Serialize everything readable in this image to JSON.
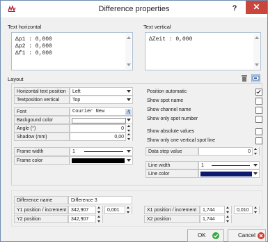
{
  "window": {
    "title": "Difference properties",
    "help": "?",
    "close": "✕"
  },
  "text_horizontal": {
    "label": "Text horizontal",
    "lines": [
      "Δp1 : 0,000",
      "Δp2 : 0,000",
      "Δf1 : 0,000"
    ]
  },
  "text_vertical": {
    "label": "Text vertical",
    "lines": [
      "ΔZeit : 0,000"
    ]
  },
  "layout": {
    "label": "Layout",
    "horizontal_text_position": {
      "label": "Horizontal text position",
      "value": "Left"
    },
    "textposition_vertical": {
      "label": "Textposition vertical",
      "value": "Top"
    },
    "font": {
      "label": "Font",
      "value": "Courier New",
      "icon": "font-icon"
    },
    "background_color": {
      "label": "Backgound color"
    },
    "angle": {
      "label": "Angle (°)",
      "value": "0"
    },
    "shadow": {
      "label": "Shadow (mm)",
      "value": "0,00"
    },
    "frame_width": {
      "label": "Frame width",
      "value": "1"
    },
    "frame_color": {
      "label": "Frame color",
      "color": "#000000"
    },
    "position_automatic": {
      "label": "Position automatic",
      "checked": true
    },
    "show_spot_name": {
      "label": "Show spot name",
      "checked": false
    },
    "show_channel_name": {
      "label": "Show channel name",
      "checked": false
    },
    "show_only_spot_number": {
      "label": "Show only spot number",
      "checked": false
    },
    "show_absolute_values": {
      "label": "Show absolute values",
      "checked": false
    },
    "show_only_one_vertical_spot_line": {
      "label": "Show only one vertical spot line",
      "checked": false
    },
    "data_step_value": {
      "label": "Data step value",
      "value": "0"
    },
    "line_width": {
      "label": "Line width",
      "value": "1"
    },
    "line_color": {
      "label": "Line color",
      "color": "#0b1a6e"
    }
  },
  "bottom": {
    "difference_name": {
      "label": "Difference name",
      "value": "Difference 3"
    },
    "y1_position": {
      "label": "Y1 position / increment",
      "value": "342,907",
      "increment": "0,001"
    },
    "y2_position": {
      "label": "Y2 position",
      "value": "342,907"
    },
    "x1_position": {
      "label": "X1 position / increment",
      "value": "1,744",
      "increment": "0,010"
    },
    "x2_position": {
      "label": "X2 position",
      "value": "1,744"
    }
  },
  "buttons": {
    "ok": "OK",
    "cancel": "Cancel"
  },
  "colors": {
    "ok_icon": "#3aa845",
    "cancel_icon": "#d23a2e"
  }
}
